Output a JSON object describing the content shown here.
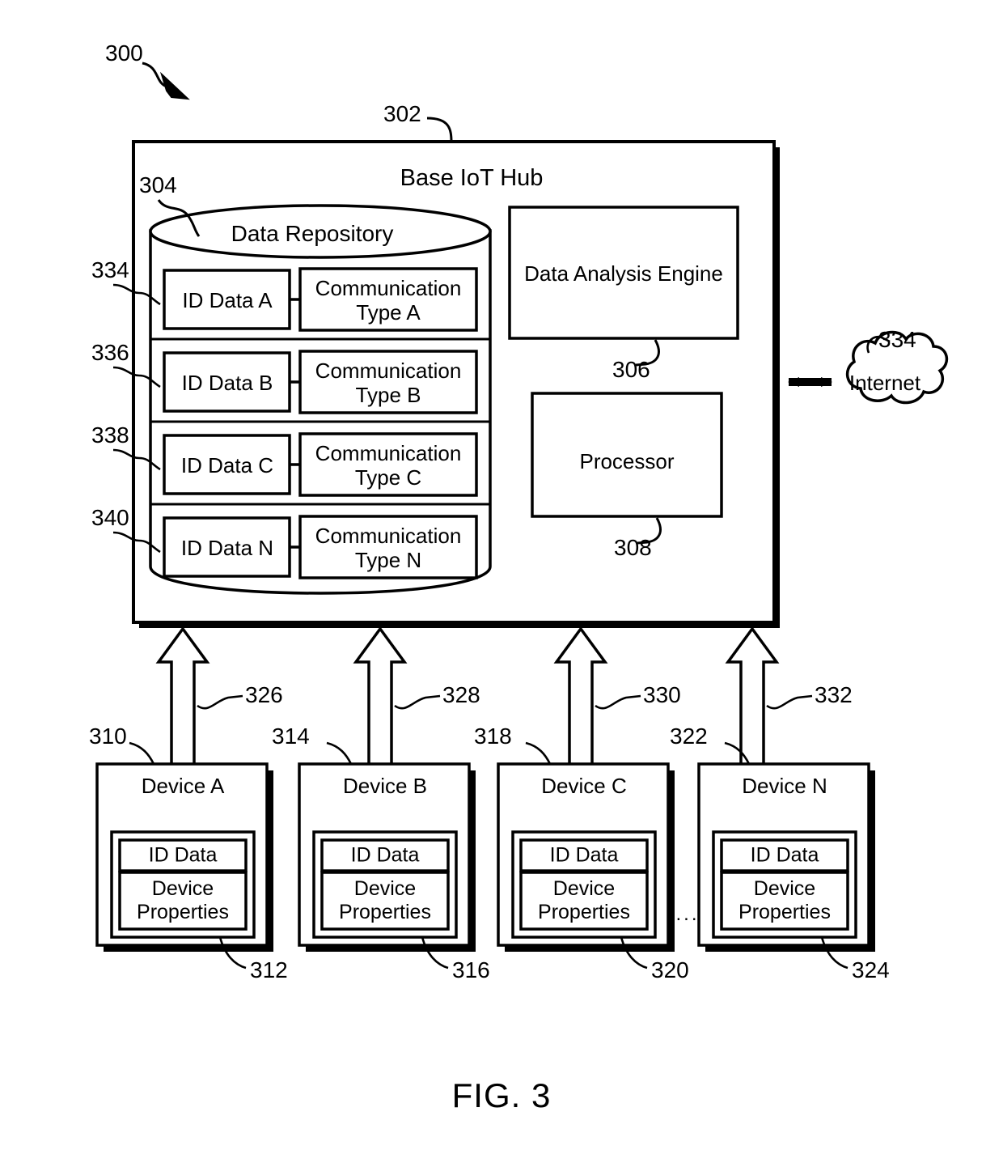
{
  "figure": {
    "caption": "FIG. 3",
    "system_ref": "300",
    "hub": {
      "title": "Base IoT Hub",
      "ref": "302",
      "repository": {
        "title": "Data Repository",
        "ref": "304",
        "rows": [
          {
            "id_label": "ID Data A",
            "comm_label": "Communication Type A",
            "ref": "334"
          },
          {
            "id_label": "ID Data B",
            "comm_label": "Communication Type B",
            "ref": "336"
          },
          {
            "id_label": "ID Data C",
            "comm_label": "Communication Type C",
            "ref": "338"
          },
          {
            "id_label": "ID Data N",
            "comm_label": "Communication Type N",
            "ref": "340"
          }
        ]
      },
      "modules": [
        {
          "label": "Data Analysis Engine",
          "ref": "306"
        },
        {
          "label": "Processor",
          "ref": "308"
        }
      ]
    },
    "cloud": {
      "label": "Internet",
      "ref": "334"
    },
    "devices": [
      {
        "title": "Device A",
        "title_ref": "310",
        "inner_ref": "312",
        "id_label": "ID Data",
        "props_label": "Device Properties",
        "link_ref": "326"
      },
      {
        "title": "Device B",
        "title_ref": "314",
        "inner_ref": "316",
        "id_label": "ID Data",
        "props_label": "Device Properties",
        "link_ref": "328"
      },
      {
        "title": "Device C",
        "title_ref": "318",
        "inner_ref": "320",
        "id_label": "ID Data",
        "props_label": "Device Properties",
        "link_ref": "330"
      },
      {
        "title": "Device N",
        "title_ref": "322",
        "inner_ref": "324",
        "id_label": "ID Data",
        "props_label": "Device Properties",
        "link_ref": "332"
      }
    ],
    "ellipsis": "...",
    "colors": {
      "stroke": "#000000",
      "background": "#ffffff",
      "shadow": "#000000"
    }
  }
}
